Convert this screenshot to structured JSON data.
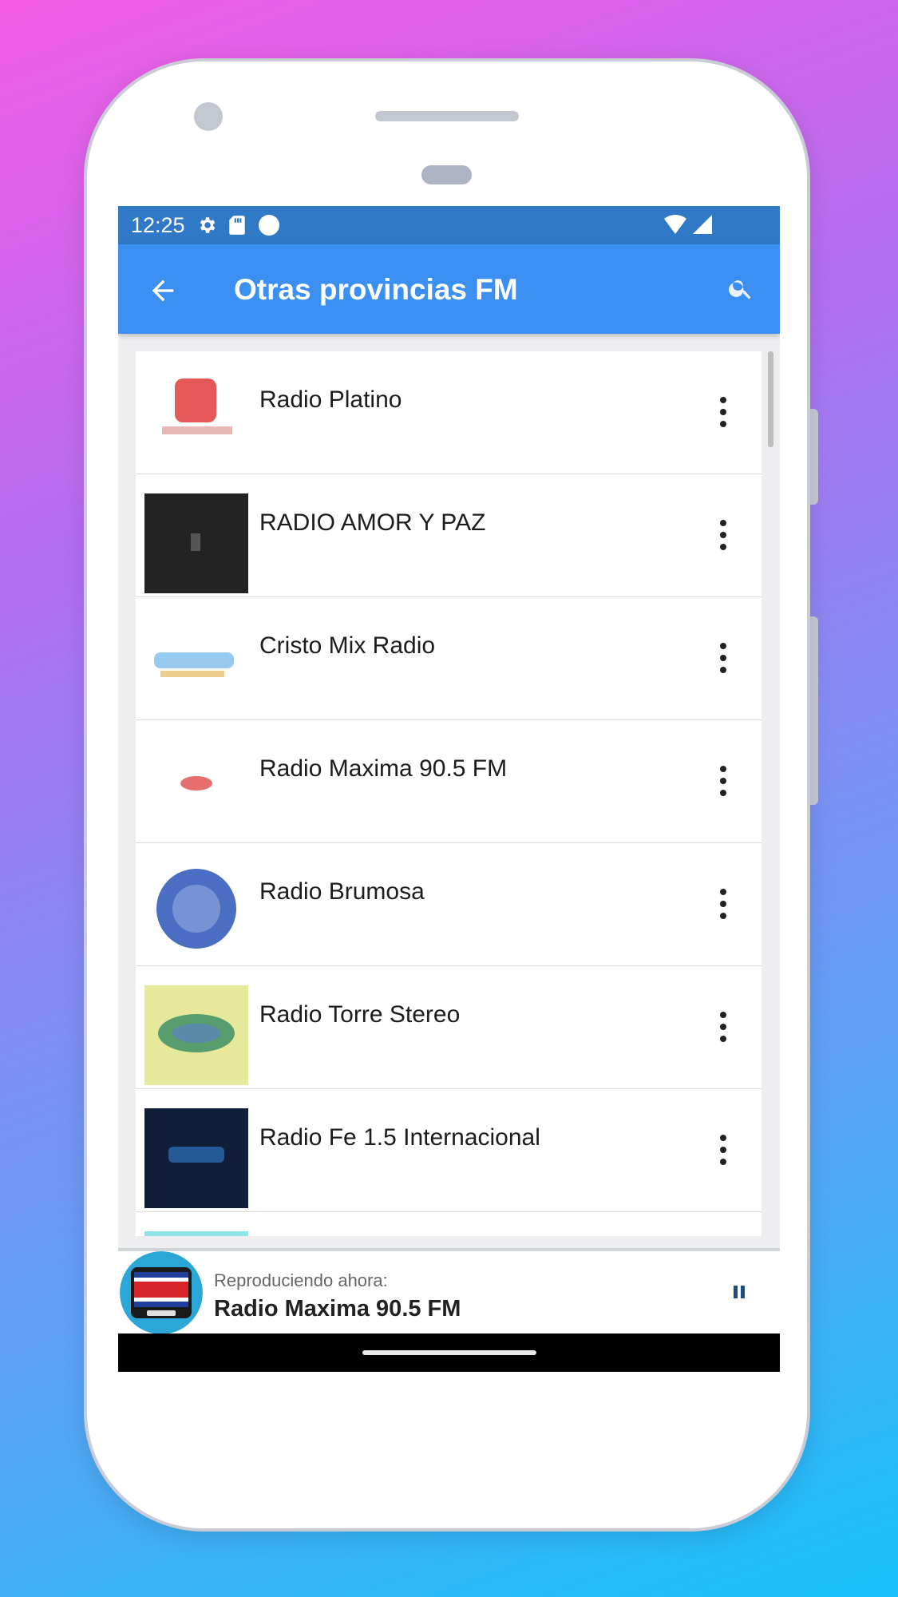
{
  "status_bar": {
    "time": "12:25"
  },
  "app_bar": {
    "title": "Otras provincias FM"
  },
  "stations": [
    {
      "name": "Radio Platino",
      "logo": "radio-platino-logo"
    },
    {
      "name": "RADIO AMOR Y PAZ",
      "logo": "radio-amor-y-paz-logo"
    },
    {
      "name": "Cristo Mix Radio",
      "logo": "cristo-mix-radio-logo"
    },
    {
      "name": "Radio Maxima 90.5 FM",
      "logo": "radio-maxima-logo"
    },
    {
      "name": "Radio Brumosa",
      "logo": "radio-brumosa-logo"
    },
    {
      "name": "Radio Torre Stereo",
      "logo": "radio-torre-stereo-logo"
    },
    {
      "name": "Radio Fe 1.5 Internacional",
      "logo": "radio-fe-logo"
    }
  ],
  "now_playing": {
    "label": "Reproduciendo ahora:",
    "station": "Radio Maxima 90.5 FM",
    "state": "playing"
  },
  "colors": {
    "status_bar": "#2f79c6",
    "app_bar": "#3b8ff0",
    "pause_icon": "#1f4e7a"
  }
}
